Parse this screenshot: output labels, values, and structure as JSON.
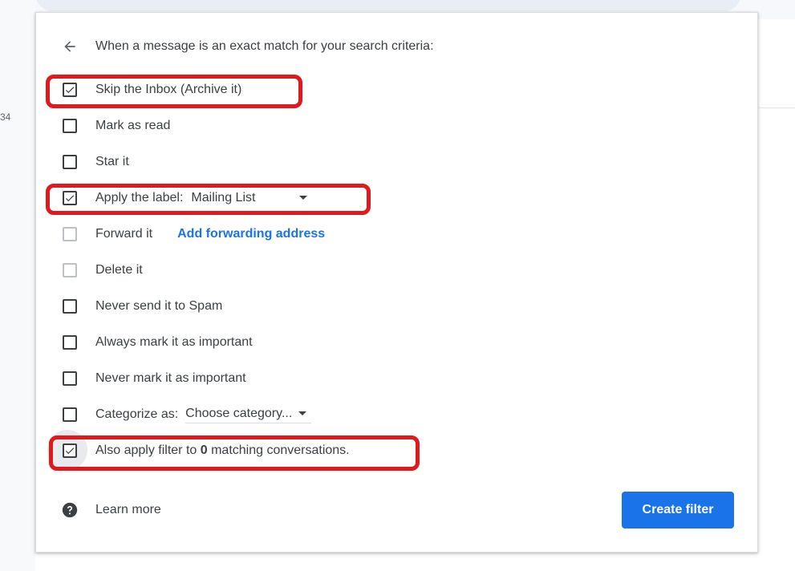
{
  "background": {
    "side_number": "34"
  },
  "header": {
    "text": "When a message is an exact match for your search criteria:"
  },
  "options": {
    "skip_inbox": {
      "label": "Skip the Inbox (Archive it)",
      "checked": true
    },
    "mark_read": {
      "label": "Mark as read",
      "checked": false
    },
    "star": {
      "label": "Star it",
      "checked": false
    },
    "apply_label": {
      "label": "Apply the label:",
      "checked": true,
      "value": "Mailing List"
    },
    "forward": {
      "label": "Forward it",
      "checked": false,
      "link": "Add forwarding address"
    },
    "delete": {
      "label": "Delete it",
      "checked": false
    },
    "never_spam": {
      "label": "Never send it to Spam",
      "checked": false
    },
    "always_important": {
      "label": "Always mark it as important",
      "checked": false
    },
    "never_important": {
      "label": "Never mark it as important",
      "checked": false
    },
    "categorize": {
      "label": "Categorize as:",
      "checked": false,
      "value": "Choose category..."
    },
    "also_apply": {
      "label_before": "Also apply filter to ",
      "count": "0",
      "label_after": " matching conversations.",
      "checked": true
    }
  },
  "footer": {
    "learn_more": "Learn more",
    "create_filter": "Create filter"
  },
  "icons": {
    "back": "arrow-back-icon",
    "help": "help-circle-icon",
    "check": "check-icon",
    "dropdown": "caret-down-icon"
  },
  "colors": {
    "accent": "#1a73e8",
    "highlight": "#e0191d",
    "text": "#3c4043"
  }
}
